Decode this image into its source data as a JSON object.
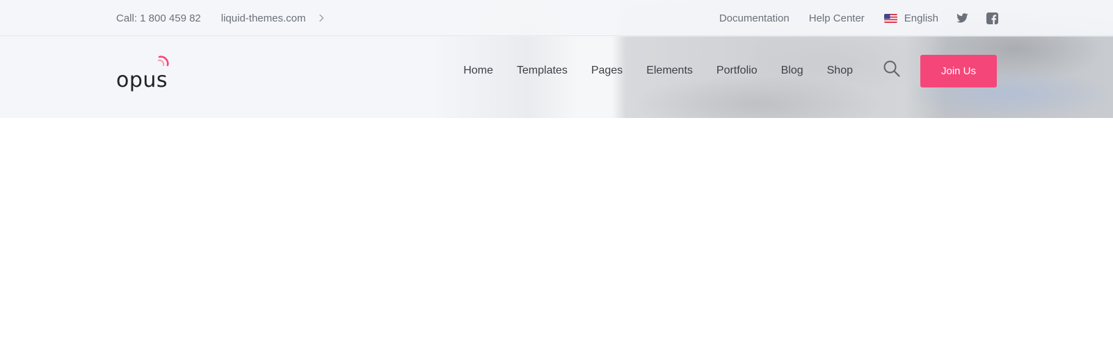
{
  "topbar": {
    "phone": "Call: 1 800 459 82",
    "site": "liquid-themes.com",
    "links": [
      "Documentation",
      "Help Center"
    ],
    "language": "English",
    "icons": [
      "chevron-right-icon",
      "us-flag-icon",
      "twitter-icon",
      "facebook-icon"
    ]
  },
  "navbar": {
    "logo": "opus",
    "menu": [
      "Home",
      "Templates",
      "Pages",
      "Elements",
      "Portfolio",
      "Blog",
      "Shop"
    ],
    "join_label": "Join Us",
    "icons": [
      "search-icon",
      "logo-mark-icon"
    ]
  },
  "colors": {
    "accent": "#f5467a",
    "text": "#3c4047",
    "muted": "#6b7079",
    "topbar_bg": "#f4f6f9"
  }
}
